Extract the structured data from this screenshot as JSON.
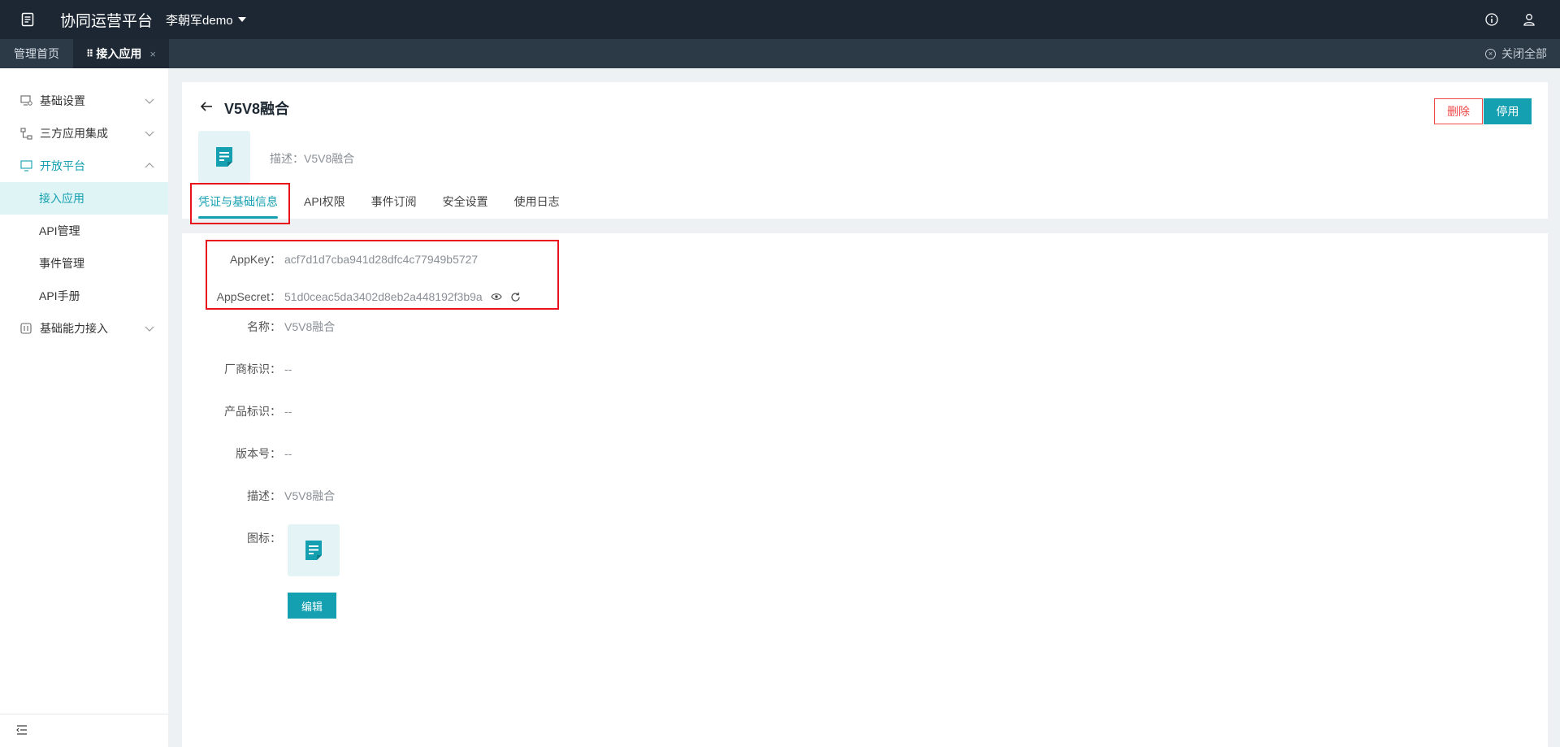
{
  "header": {
    "app_title": "协同运营平台",
    "tenant": "李朝军demo"
  },
  "tabs_bar": {
    "tabs": [
      {
        "label": "管理首页"
      },
      {
        "label": "接入应用",
        "active": true,
        "close": "×"
      }
    ],
    "close_all_label": "关闭全部"
  },
  "sidebar": {
    "groups": [
      {
        "label": "基础设置",
        "icon": "monitor-settings-icon"
      },
      {
        "label": "三方应用集成",
        "icon": "flow-icon"
      },
      {
        "label": "开放平台",
        "icon": "screen-icon",
        "open": true,
        "items": [
          {
            "label": "接入应用",
            "active": true
          },
          {
            "label": "API管理"
          },
          {
            "label": "事件管理"
          },
          {
            "label": "API手册"
          }
        ]
      },
      {
        "label": "基础能力接入",
        "icon": "chip-icon"
      }
    ]
  },
  "app": {
    "name": "V5V8融合",
    "desc_label": "描述：",
    "desc_value": "V5V8融合",
    "delete_label": "删除",
    "disable_label": "停用"
  },
  "detail_tabs": [
    {
      "label": "凭证与基础信息",
      "active": true
    },
    {
      "label": "API权限"
    },
    {
      "label": "事件订阅"
    },
    {
      "label": "安全设置"
    },
    {
      "label": "使用日志"
    }
  ],
  "fields": {
    "appkey": {
      "label": "AppKey：",
      "value": "acf7d1d7cba941d28dfc4c77949b5727"
    },
    "appsecret": {
      "label": "AppSecret：",
      "value": "51d0ceac5da3402d8eb2a448192f3b9a"
    },
    "name": {
      "label": "名称：",
      "value": "V5V8融合"
    },
    "vendor": {
      "label": "厂商标识：",
      "value": "--"
    },
    "product": {
      "label": "产品标识：",
      "value": "--"
    },
    "version": {
      "label": "版本号：",
      "value": "--"
    },
    "desc": {
      "label": "描述：",
      "value": "V5V8融合"
    },
    "icon": {
      "label": "图标："
    }
  },
  "edit_label": "编辑",
  "colors": {
    "accent": "#14a0b0",
    "topbar": "#1c2733",
    "tabbar": "#2c3a48",
    "danger": "#f04848",
    "highlight_box": "#e8131c"
  }
}
